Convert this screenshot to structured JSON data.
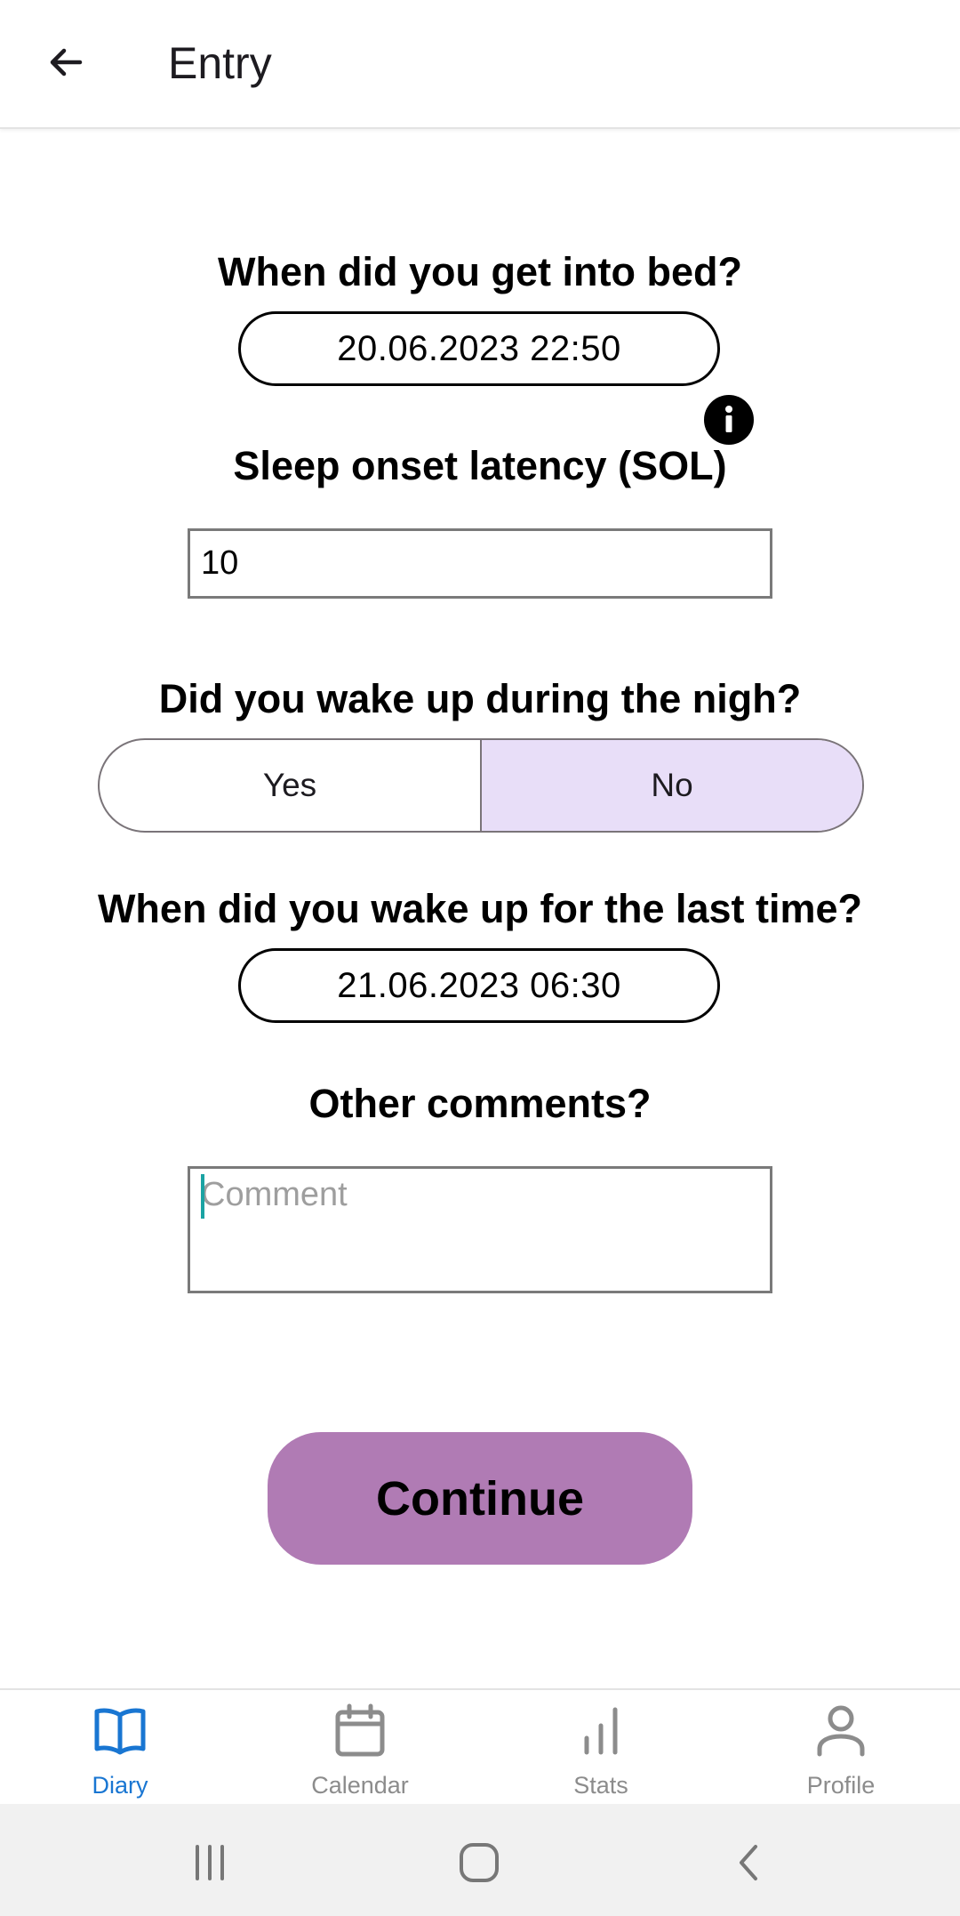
{
  "header": {
    "title": "Entry"
  },
  "form": {
    "bed_question": "When did you get into bed?",
    "bed_time": "20.06.2023 22:50",
    "sol_question": "Sleep onset latency (SOL)",
    "sol_value": "10",
    "wake_night_question": "Did you wake up during the nigh?",
    "wake_night_options": {
      "yes": "Yes",
      "no": "No",
      "selected": "No"
    },
    "last_wake_question": "When did you wake up for the last time?",
    "last_wake_time": "21.06.2023 06:30",
    "comments_question": "Other comments?",
    "comment_placeholder": "Comment",
    "continue_label": "Continue"
  },
  "bottom_nav": {
    "items": [
      {
        "label": "Diary",
        "icon": "book-icon",
        "active": true
      },
      {
        "label": "Calendar",
        "icon": "calendar-icon",
        "active": false
      },
      {
        "label": "Stats",
        "icon": "bar-chart-icon",
        "active": false
      },
      {
        "label": "Profile",
        "icon": "person-icon",
        "active": false
      }
    ]
  },
  "colors": {
    "accent": "#1976d2",
    "continue_button": "#b07bb4",
    "selected_segment": "#e8def8"
  }
}
